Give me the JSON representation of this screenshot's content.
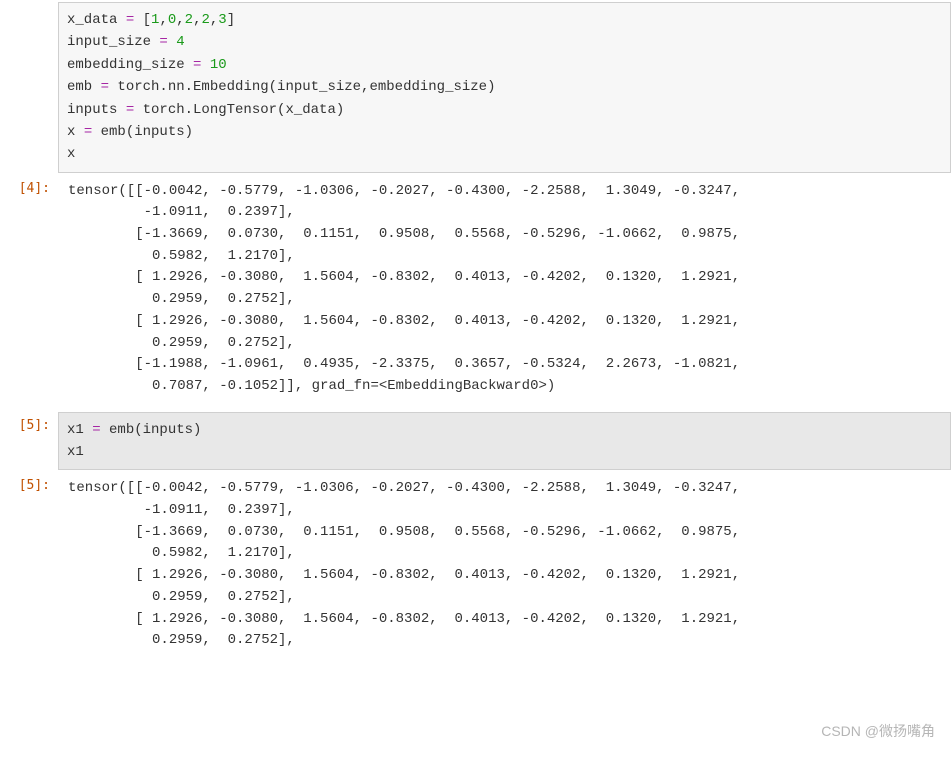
{
  "cells": {
    "c1": {
      "code_html": "x_data <span class='tk-op'>=</span> [<span class='tk-num'>1</span>,<span class='tk-num'>0</span>,<span class='tk-num'>2</span>,<span class='tk-num'>2</span>,<span class='tk-num'>3</span>]\ninput_size <span class='tk-op'>=</span> <span class='tk-num'>4</span>\nembedding_size <span class='tk-op'>=</span> <span class='tk-num'>10</span>\nemb <span class='tk-op'>=</span> torch.nn.Embedding(input_size,embedding_size)\ninputs <span class='tk-op'>=</span> torch.LongTensor(x_data)\nx <span class='tk-op'>=</span> emb(inputs)\nx"
    },
    "o1": {
      "prompt": "[4]:",
      "text": "tensor([[-0.0042, -0.5779, -1.0306, -0.2027, -0.4300, -2.2588,  1.3049, -0.3247,\n         -1.0911,  0.2397],\n        [-1.3669,  0.0730,  0.1151,  0.9508,  0.5568, -0.5296, -1.0662,  0.9875,\n          0.5982,  1.2170],\n        [ 1.2926, -0.3080,  1.5604, -0.8302,  0.4013, -0.4202,  0.1320,  1.2921,\n          0.2959,  0.2752],\n        [ 1.2926, -0.3080,  1.5604, -0.8302,  0.4013, -0.4202,  0.1320,  1.2921,\n          0.2959,  0.2752],\n        [-1.1988, -1.0961,  0.4935, -2.3375,  0.3657, -0.5324,  2.2673, -1.0821,\n          0.7087, -0.1052]], grad_fn=<EmbeddingBackward0>)"
    },
    "c2": {
      "prompt": "[5]:",
      "code_html": "x1 <span class='tk-op'>=</span> emb(inputs)\nx1"
    },
    "o2": {
      "prompt": "[5]:",
      "text": "tensor([[-0.0042, -0.5779, -1.0306, -0.2027, -0.4300, -2.2588,  1.3049, -0.3247,\n         -1.0911,  0.2397],\n        [-1.3669,  0.0730,  0.1151,  0.9508,  0.5568, -0.5296, -1.0662,  0.9875,\n          0.5982,  1.2170],\n        [ 1.2926, -0.3080,  1.5604, -0.8302,  0.4013, -0.4202,  0.1320,  1.2921,\n          0.2959,  0.2752],\n        [ 1.2926, -0.3080,  1.5604, -0.8302,  0.4013, -0.4202,  0.1320,  1.2921,\n          0.2959,  0.2752],"
    }
  },
  "watermark": "CSDN @微扬嘴角"
}
